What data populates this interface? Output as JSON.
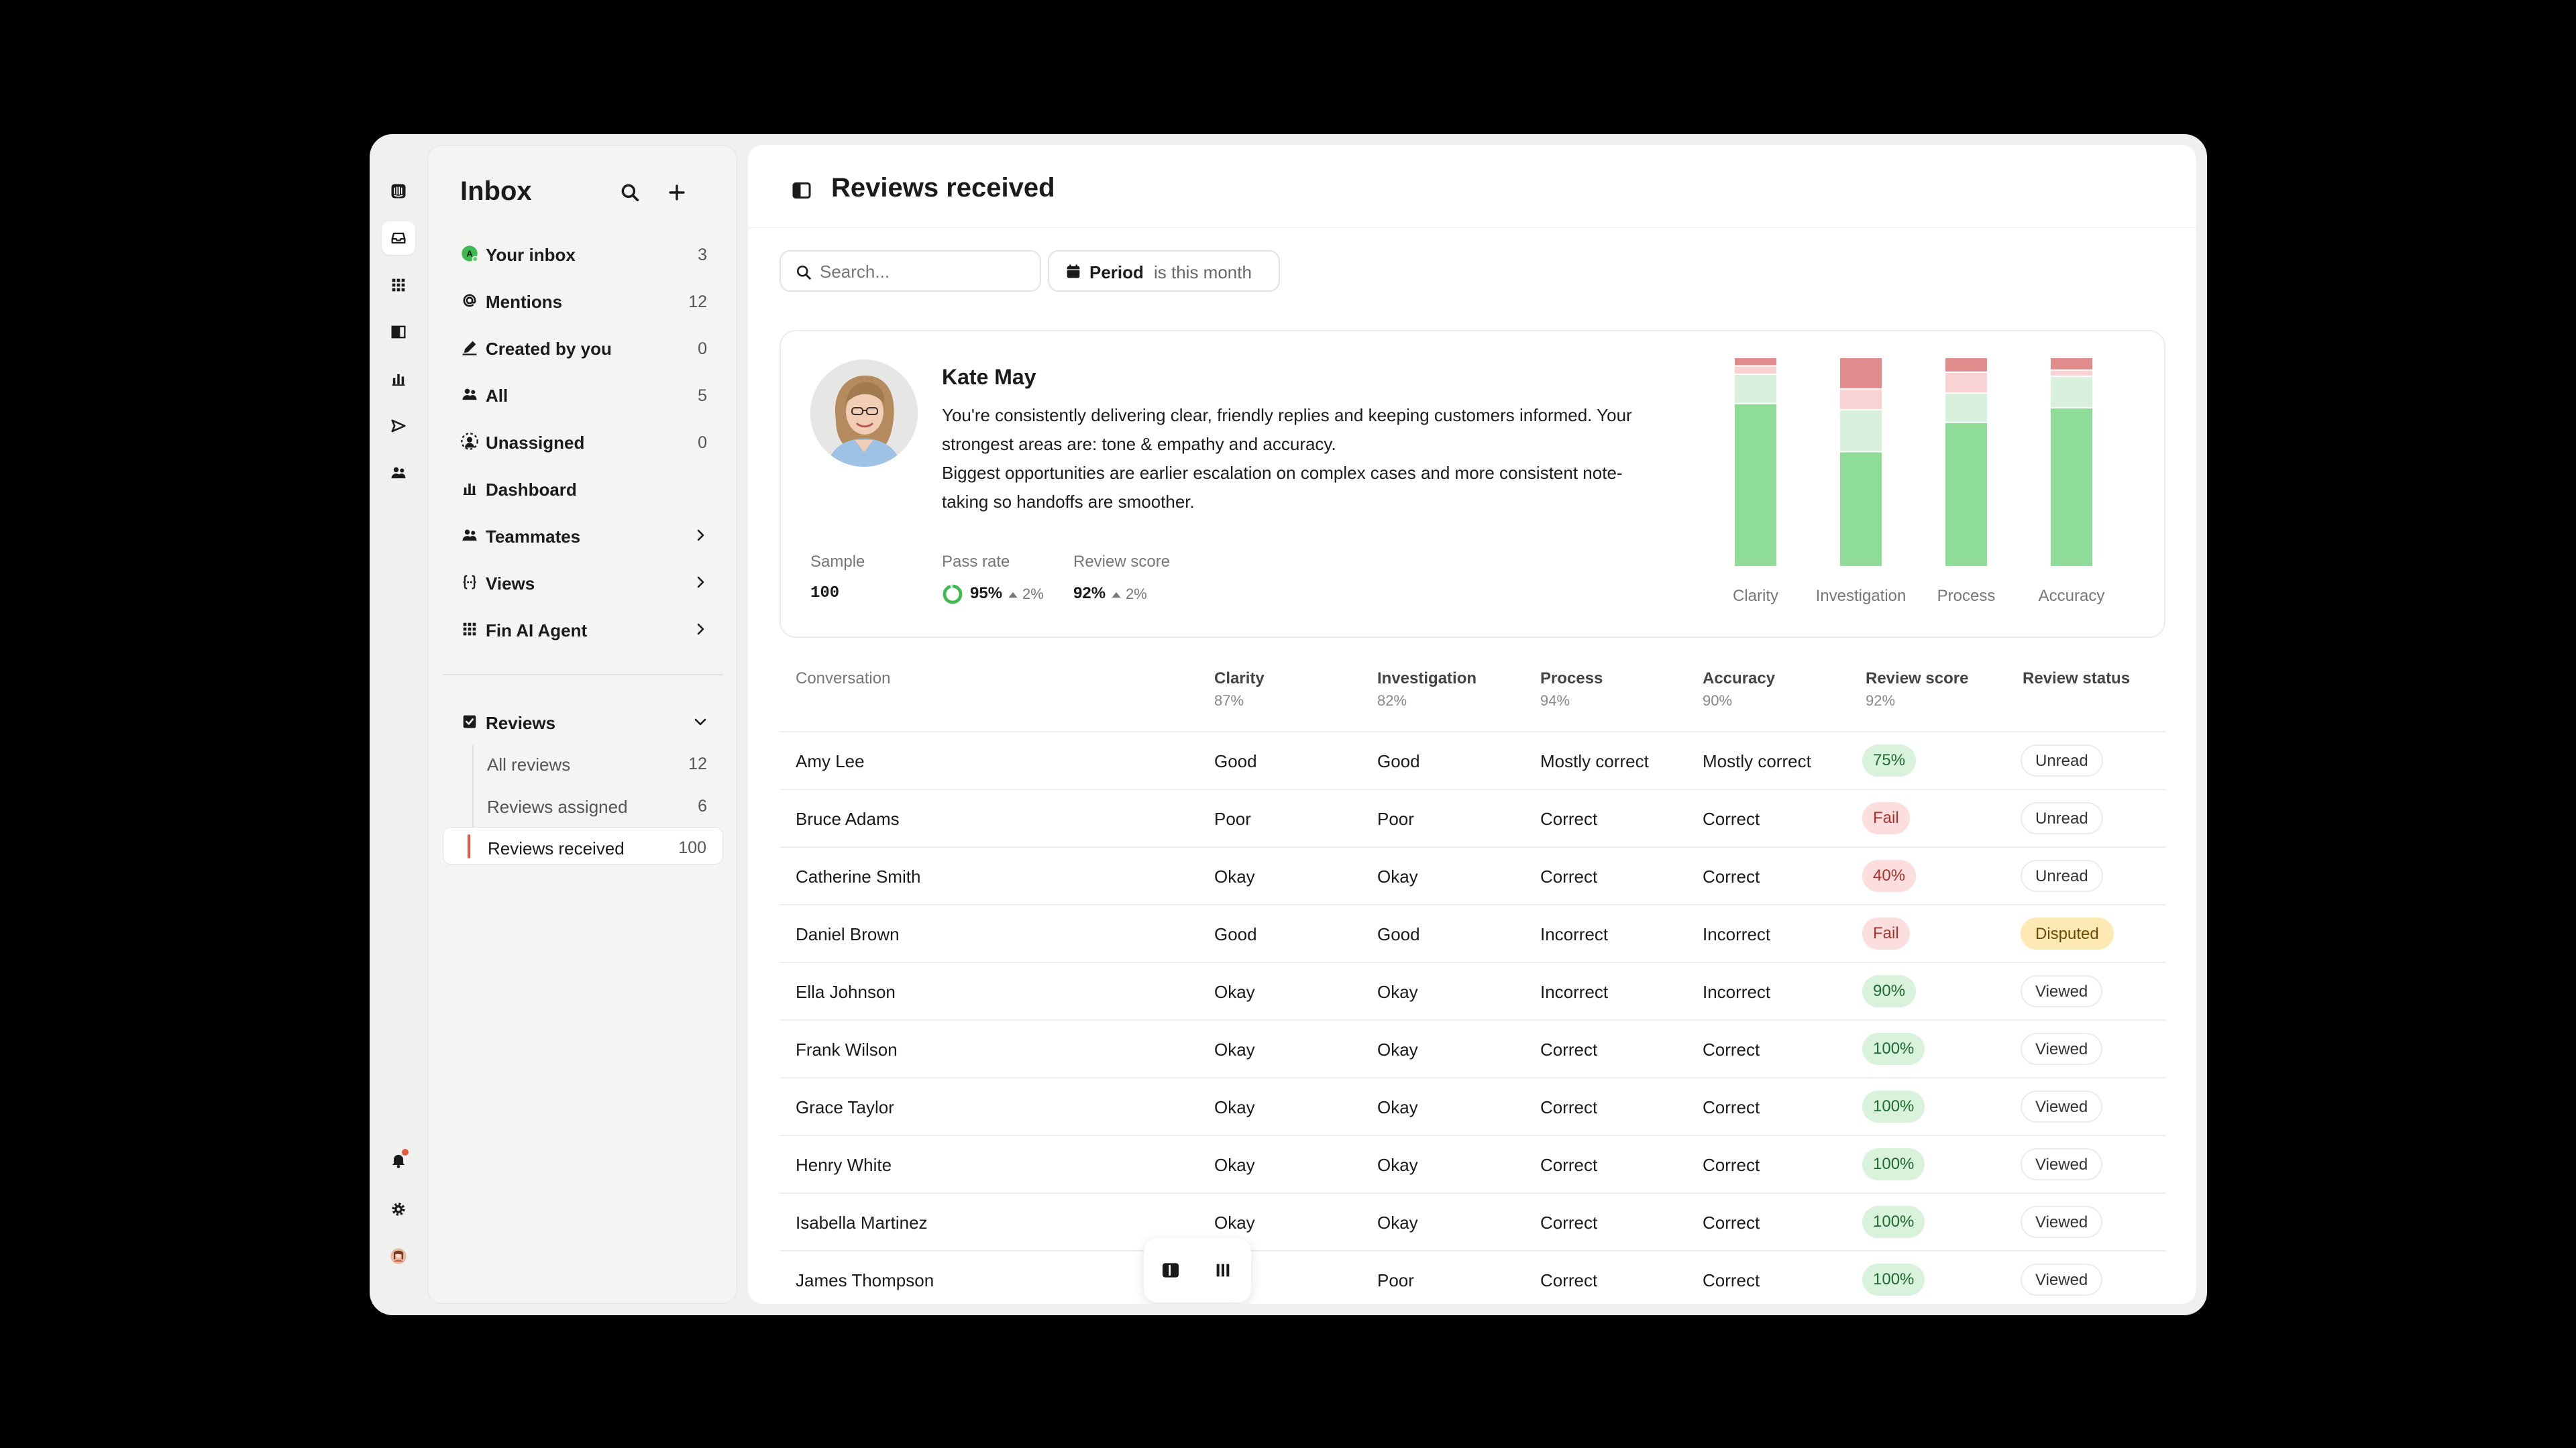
{
  "nav": {
    "title": "Inbox",
    "items": [
      {
        "label": "Your inbox",
        "count": "3",
        "icon": "avatar-dot-icon"
      },
      {
        "label": "Mentions",
        "count": "12",
        "icon": "at-icon"
      },
      {
        "label": "Created by you",
        "count": "0",
        "icon": "pen-icon"
      },
      {
        "label": "All",
        "count": "5",
        "icon": "people-icon"
      },
      {
        "label": "Unassigned",
        "count": "0",
        "icon": "unassigned-icon"
      },
      {
        "label": "Dashboard",
        "count": "",
        "icon": "bar-chart-icon"
      },
      {
        "label": "Teammates",
        "count": "",
        "icon": "people-icon"
      },
      {
        "label": "Views",
        "count": "",
        "icon": "braces-icon"
      },
      {
        "label": "Fin AI Agent",
        "count": "",
        "icon": "grid-icon"
      }
    ],
    "reviews": {
      "label": "Reviews",
      "sub": [
        {
          "label": "All reviews",
          "count": "12"
        },
        {
          "label": "Reviews assigned",
          "count": "6"
        },
        {
          "label": "Reviews received",
          "count": "100"
        }
      ]
    }
  },
  "main": {
    "title": "Reviews received",
    "search_placeholder": "Search...",
    "period_key": "Period",
    "period_value": "is this month"
  },
  "summary": {
    "name": "Kate May",
    "text1": "You're consistently delivering clear, friendly replies and keeping customers informed. Your strongest areas are: tone & empathy and accuracy.",
    "text2": "Biggest opportunities are earlier escalation on complex cases and more consistent note-taking so handoffs are smoother.",
    "sample_label": "Sample",
    "sample_value": "100",
    "pass_label": "Pass rate",
    "pass_value": "95%",
    "pass_delta": "2%",
    "score_label": "Review score",
    "score_value": "92%",
    "score_delta": "2%"
  },
  "chart_data": {
    "type": "bar",
    "stacked": true,
    "categories": [
      "Clarity",
      "Investigation",
      "Process",
      "Accuracy"
    ],
    "series": [
      {
        "color": "#8fdc99",
        "values": [
          78,
          55,
          69,
          76
        ]
      },
      {
        "color": "#d7f1dc",
        "values": [
          14,
          20,
          14,
          15
        ]
      },
      {
        "color": "#f9d3d3",
        "values": [
          4,
          10,
          10,
          3
        ]
      },
      {
        "color": "#e08c8c",
        "values": [
          4,
          15,
          7,
          6
        ]
      }
    ],
    "ylim": [
      0,
      100
    ]
  },
  "table": {
    "columns": [
      {
        "label": "Conversation",
        "sub": ""
      },
      {
        "label": "Clarity",
        "sub": "87%"
      },
      {
        "label": "Investigation",
        "sub": "82%"
      },
      {
        "label": "Process",
        "sub": "94%"
      },
      {
        "label": "Accuracy",
        "sub": "90%"
      },
      {
        "label": "Review score",
        "sub": "92%"
      },
      {
        "label": "Review status",
        "sub": ""
      }
    ],
    "rows": [
      {
        "name": "Amy Lee",
        "clarity": "Good",
        "investigation": "Good",
        "process": "Mostly correct",
        "accuracy": "Mostly correct",
        "score": "75%",
        "score_kind": "green",
        "status": "Unread"
      },
      {
        "name": "Bruce Adams",
        "clarity": "Poor",
        "investigation": "Poor",
        "process": "Correct",
        "accuracy": "Correct",
        "score": "Fail",
        "score_kind": "red",
        "status": "Unread"
      },
      {
        "name": "Catherine Smith",
        "clarity": "Okay",
        "investigation": "Okay",
        "process": "Correct",
        "accuracy": "Correct",
        "score": "40%",
        "score_kind": "red",
        "status": "Unread"
      },
      {
        "name": "Daniel Brown",
        "clarity": "Good",
        "investigation": "Good",
        "process": "Incorrect",
        "accuracy": "Incorrect",
        "score": "Fail",
        "score_kind": "red",
        "status": "Disputed"
      },
      {
        "name": "Ella Johnson",
        "clarity": "Okay",
        "investigation": "Okay",
        "process": "Incorrect",
        "accuracy": "Incorrect",
        "score": "90%",
        "score_kind": "green",
        "status": "Viewed"
      },
      {
        "name": "Frank Wilson",
        "clarity": "Okay",
        "investigation": "Okay",
        "process": "Correct",
        "accuracy": "Correct",
        "score": "100%",
        "score_kind": "green",
        "status": "Viewed"
      },
      {
        "name": "Grace Taylor",
        "clarity": "Okay",
        "investigation": "Okay",
        "process": "Correct",
        "accuracy": "Correct",
        "score": "100%",
        "score_kind": "green",
        "status": "Viewed"
      },
      {
        "name": "Henry White",
        "clarity": "Okay",
        "investigation": "Okay",
        "process": "Correct",
        "accuracy": "Correct",
        "score": "100%",
        "score_kind": "green",
        "status": "Viewed"
      },
      {
        "name": "Isabella Martinez",
        "clarity": "Okay",
        "investigation": "Okay",
        "process": "Correct",
        "accuracy": "Correct",
        "score": "100%",
        "score_kind": "green",
        "status": "Viewed"
      },
      {
        "name": "James Thompson",
        "clarity": "Poor",
        "investigation": "Poor",
        "process": "Correct",
        "accuracy": "Correct",
        "score": "100%",
        "score_kind": "green",
        "status": "Viewed"
      }
    ]
  }
}
